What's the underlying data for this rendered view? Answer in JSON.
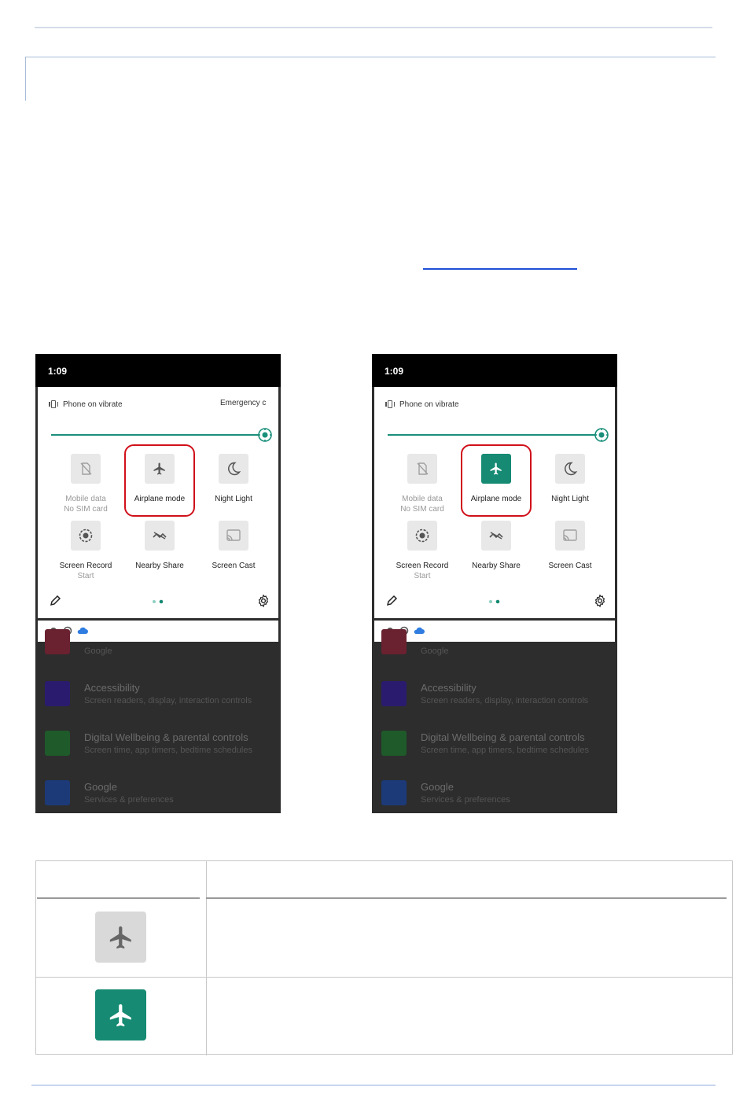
{
  "left_phone": {
    "time": "1:09",
    "vibrate_label": "Phone on vibrate",
    "emergency_label": "Emergency c",
    "tiles": {
      "mobile_data": {
        "label": "Mobile data",
        "sub": "No SIM card"
      },
      "airplane": {
        "label": "Airplane mode",
        "state": "off"
      },
      "night_light": {
        "label": "Night Light"
      },
      "screen_record": {
        "label": "Screen Record",
        "sub": "Start"
      },
      "nearby_share": {
        "label": "Nearby Share"
      },
      "screen_cast": {
        "label": "Screen Cast"
      }
    },
    "background_list": [
      {
        "title": "",
        "sub": "Google"
      },
      {
        "title": "Accessibility",
        "sub": "Screen readers, display, interaction controls"
      },
      {
        "title": "Digital Wellbeing & parental controls",
        "sub": "Screen time, app timers, bedtime schedules"
      },
      {
        "title": "Google",
        "sub": "Services & preferences"
      }
    ]
  },
  "right_phone": {
    "time": "1:09",
    "vibrate_label": "Phone on vibrate",
    "tiles": {
      "mobile_data": {
        "label": "Mobile data",
        "sub": "No SIM card"
      },
      "airplane": {
        "label": "Airplane mode",
        "state": "on"
      },
      "night_light": {
        "label": "Night Light"
      },
      "screen_record": {
        "label": "Screen Record",
        "sub": "Start"
      },
      "nearby_share": {
        "label": "Nearby Share"
      },
      "screen_cast": {
        "label": "Screen Cast"
      }
    },
    "background_list": [
      {
        "title": "",
        "sub": "Google"
      },
      {
        "title": "Accessibility",
        "sub": "Screen readers, display, interaction controls"
      },
      {
        "title": "Digital Wellbeing & parental controls",
        "sub": "Screen time, app timers, bedtime schedules"
      },
      {
        "title": "Google",
        "sub": "Services & preferences"
      }
    ]
  },
  "colors": {
    "accent_teal": "#168a73",
    "highlight_red": "#d0101a",
    "tile_off_gray": "#e8e8e8"
  },
  "icons": {
    "airplane": "airplane-icon",
    "mobile_data": "no-sim-icon",
    "night_light": "moon-icon",
    "screen_record": "record-icon",
    "nearby_share": "nearby-share-icon",
    "screen_cast": "cast-icon",
    "edit": "pencil-icon",
    "settings": "gear-icon",
    "vibrate": "vibrate-icon",
    "brightness": "brightness-icon"
  }
}
